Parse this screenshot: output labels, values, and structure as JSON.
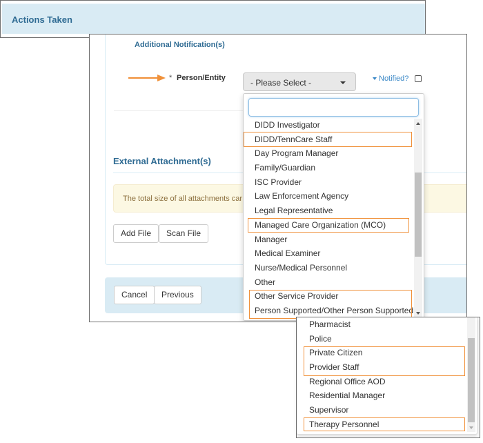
{
  "actions_panel": {
    "title": "Actions Taken"
  },
  "form": {
    "additional_notifications_title": "Additional Notification(s)",
    "person_entity": {
      "required_marker": "*",
      "label": "Person/Entity",
      "selected_value": "- Please Select -",
      "search_value": ""
    },
    "notified": {
      "label": "Notified?",
      "checked": false
    },
    "external_attachments": {
      "title": "External Attachment(s)",
      "warning_text": "The total size of all attachments car",
      "add_file_label": "Add File",
      "scan_file_label": "Scan File"
    },
    "footer": {
      "cancel_label": "Cancel",
      "previous_label": "Previous"
    }
  },
  "dropdown_options_part1": [
    "DIDD Investigator",
    "DIDD/TennCare Staff",
    "Day Program Manager",
    "Family/Guardian",
    "ISC Provider",
    "Law Enforcement Agency",
    "Legal Representative",
    "Managed Care Organization (MCO)",
    "Manager",
    "Medical Examiner",
    "Nurse/Medical Personnel",
    "Other",
    "Other Service Provider",
    "Person Supported/Other Person Supported"
  ],
  "dropdown_options_part2": [
    "Pharmacist",
    "Police",
    "Private Citizen",
    "Provider Staff",
    "Regional Office AOD",
    "Residential Manager",
    "Supervisor",
    "Therapy Personnel"
  ],
  "highlighted_options": [
    "DIDD/TennCare Staff",
    "Managed Care Organization (MCO)",
    "Other Service Provider",
    "Person Supported/Other Person Supported",
    "Private Citizen",
    "Provider Staff",
    "Therapy Personnel"
  ],
  "colors": {
    "accent_orange": "#f0913a",
    "header_blue": "#2f6b93",
    "panel_blue": "#d9ebf4",
    "link_blue": "#3a88c7",
    "warning_bg": "#fcf8e3"
  }
}
